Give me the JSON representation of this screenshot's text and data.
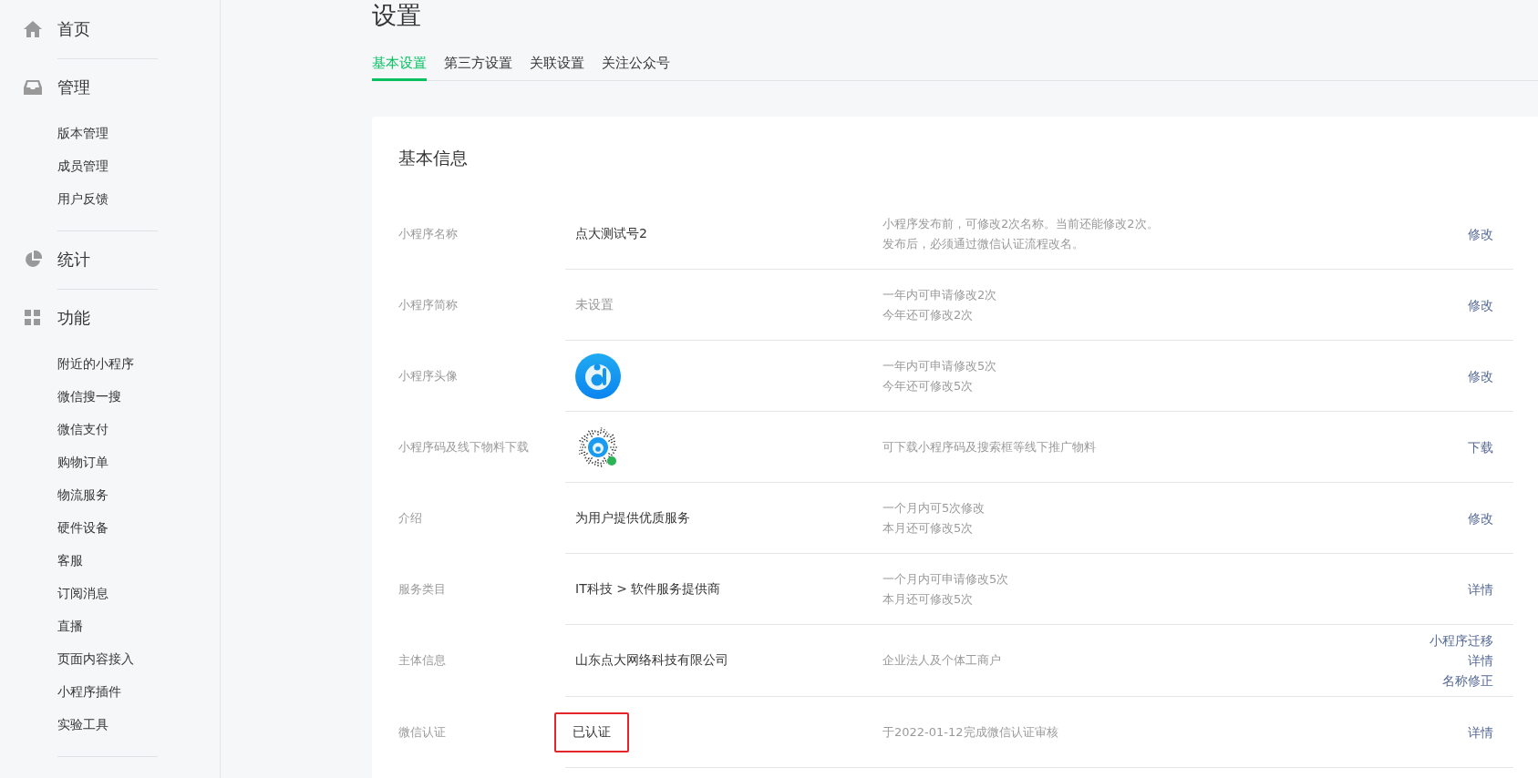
{
  "sidebar": {
    "groups": [
      {
        "label": "首页"
      },
      {
        "label": "管理",
        "children": [
          {
            "label": "版本管理"
          },
          {
            "label": "成员管理"
          },
          {
            "label": "用户反馈"
          }
        ]
      },
      {
        "label": "统计"
      },
      {
        "label": "功能",
        "children": [
          {
            "label": "附近的小程序"
          },
          {
            "label": "微信搜一搜"
          },
          {
            "label": "微信支付"
          },
          {
            "label": "购物订单"
          },
          {
            "label": "物流服务"
          },
          {
            "label": "硬件设备"
          },
          {
            "label": "客服"
          },
          {
            "label": "订阅消息"
          },
          {
            "label": "直播"
          },
          {
            "label": "页面内容接入"
          },
          {
            "label": "小程序插件"
          },
          {
            "label": "实验工具"
          }
        ]
      }
    ]
  },
  "page": {
    "title": "设置"
  },
  "tabs": [
    {
      "label": "基本设置",
      "selected": true
    },
    {
      "label": "第三方设置",
      "selected": false
    },
    {
      "label": "关联设置",
      "selected": false
    },
    {
      "label": "关注公众号",
      "selected": false
    }
  ],
  "card": {
    "title": "基本信息",
    "rows": [
      {
        "label": "小程序名称",
        "kind": "text",
        "value": "点大测试号2",
        "description": [
          "小程序发布前，可修改2次名称。当前还能修改2次。",
          "发布后，必须通过微信认证流程改名。"
        ],
        "actions": [
          "修改"
        ]
      },
      {
        "label": "小程序简称",
        "kind": "muted",
        "value": "未设置",
        "description": [
          "一年内可申请修改2次",
          "今年还可修改2次"
        ],
        "actions": [
          "修改"
        ]
      },
      {
        "label": "小程序头像",
        "kind": "avatar",
        "description": [
          "一年内可申请修改5次",
          "今年还可修改5次"
        ],
        "actions": [
          "修改"
        ]
      },
      {
        "label": "小程序码及线下物料下载",
        "kind": "qrcode",
        "description": [
          "可下载小程序码及搜索框等线下推广物料"
        ],
        "actions": [
          "下载"
        ]
      },
      {
        "label": "介绍",
        "kind": "text",
        "value": "为用户提供优质服务",
        "description": [
          "一个月内可5次修改",
          "本月还可修改5次"
        ],
        "actions": [
          "修改"
        ]
      },
      {
        "label": "服务类目",
        "kind": "text",
        "value": "IT科技 > 软件服务提供商",
        "description": [
          "一个月内可申请修改5次",
          "本月还可修改5次"
        ],
        "actions": [
          "详情"
        ]
      },
      {
        "label": "主体信息",
        "kind": "text",
        "value": "山东点大网络科技有限公司",
        "description": [
          "企业法人及个体工商户"
        ],
        "actions": [
          "小程序迁移",
          "详情",
          "名称修正"
        ]
      },
      {
        "label": "微信认证",
        "kind": "boxed",
        "value": "已认证",
        "description": [
          "于2022-01-12完成微信认证审核"
        ],
        "actions": [
          "详情"
        ]
      }
    ]
  }
}
